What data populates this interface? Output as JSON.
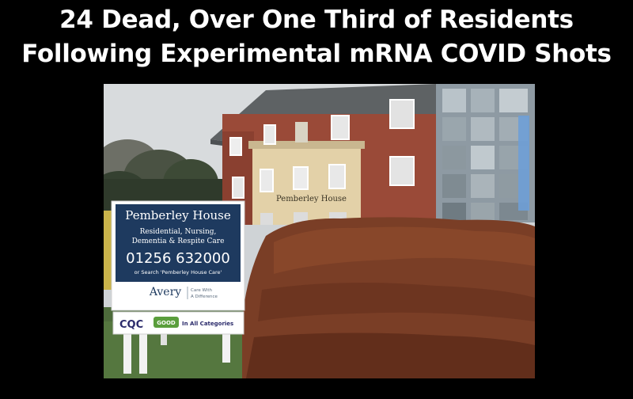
{
  "headline": {
    "line1": "24 Dead, Over One Third of Residents",
    "line2": "Following Experimental mRNA COVID Shots"
  },
  "photo": {
    "building_sign": "Pemberley House",
    "board": {
      "name": "Pemberley House",
      "services_line1": "Residential, Nursing,",
      "services_line2": "Dementia & Respite Care",
      "phone": "01256 632000",
      "search_hint": "or Search 'Pemberley House Care'",
      "brand": "Avery",
      "tagline_line1": "Care With",
      "tagline_line2": "A Difference",
      "regulator": "CQC",
      "rating": "GOOD",
      "rating_scope": "In All Categories"
    }
  },
  "colors": {
    "background": "#000000",
    "headline_text": "#ffffff",
    "sign_navy": "#1e3a5f",
    "cqc_green": "#5a9e3c",
    "brick": "#9a4a38",
    "hedge": "#7a3e26"
  }
}
